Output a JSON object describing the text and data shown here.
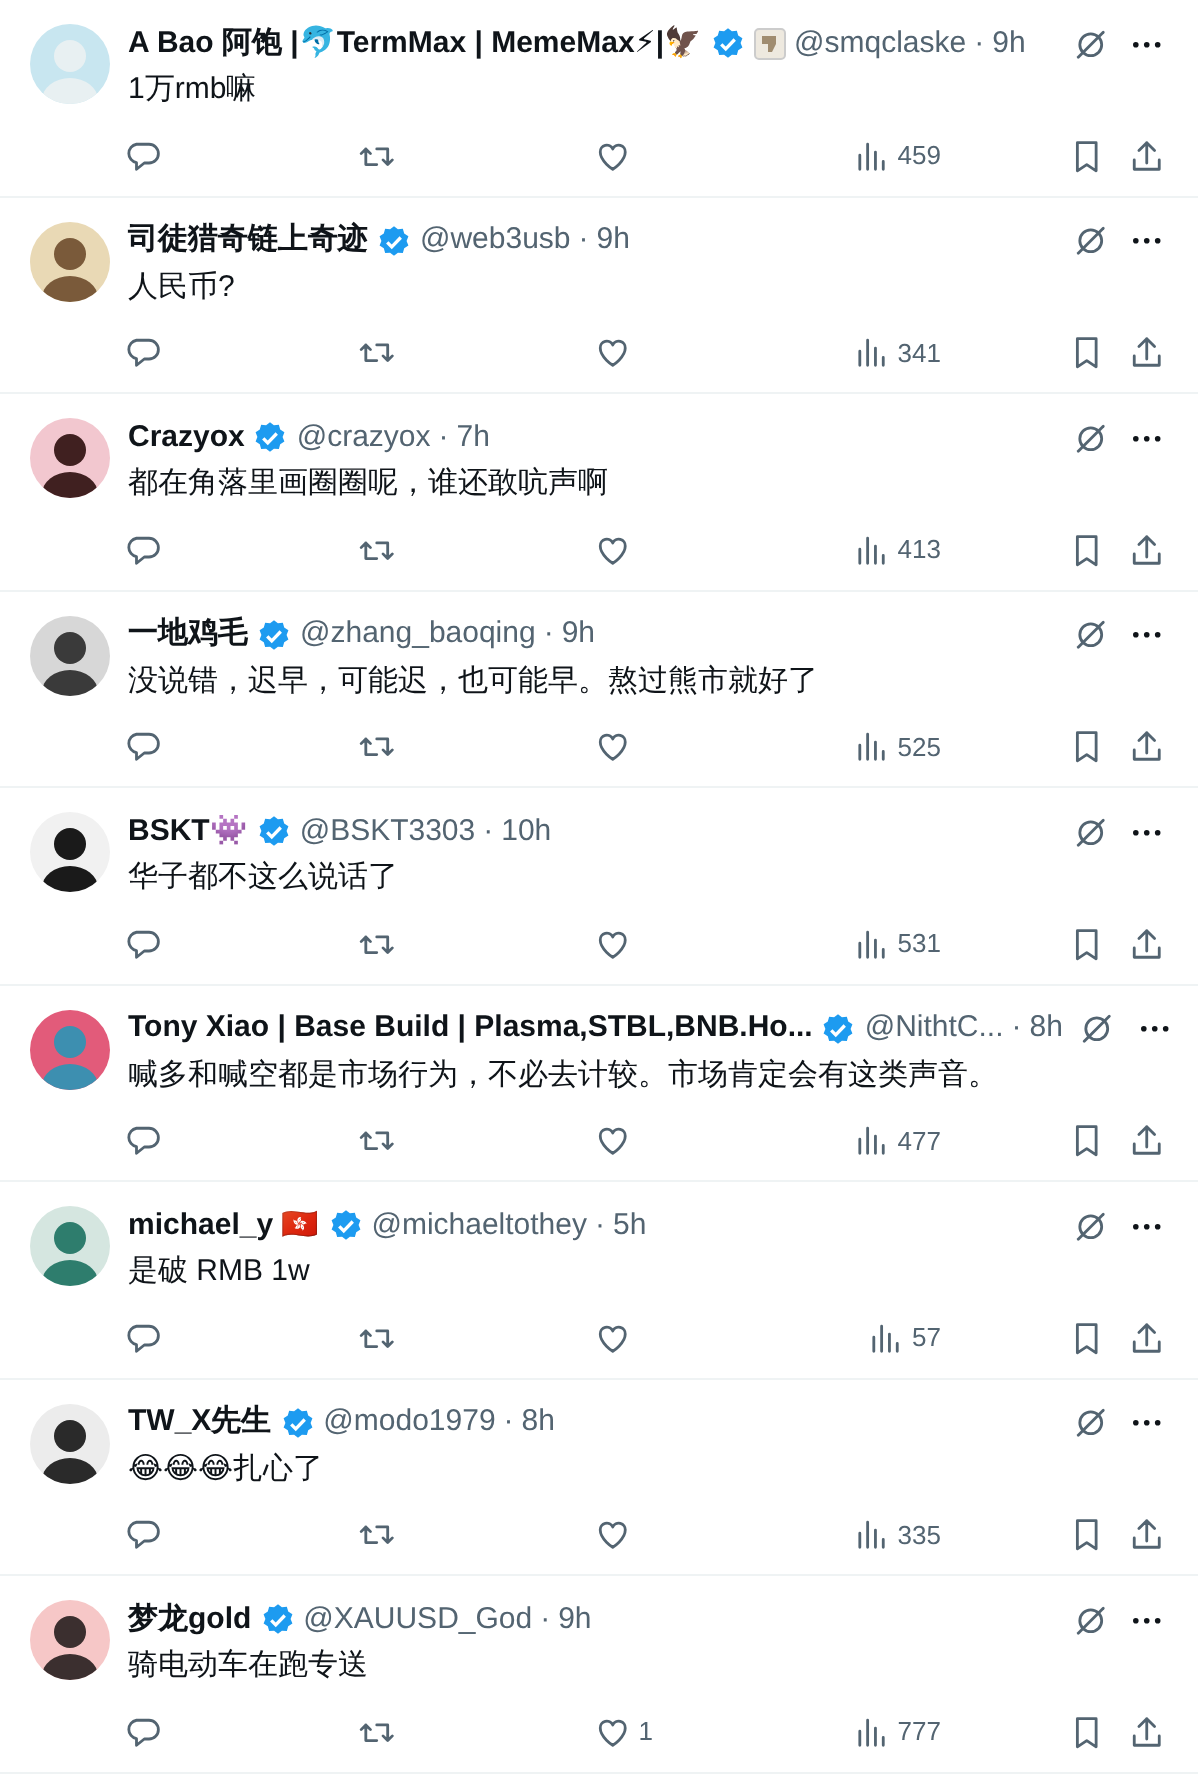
{
  "tweets": [
    {
      "name": "A Bao 阿饱 |🐬TermMax | MemeMax⚡|🦅",
      "verified": true,
      "affiliate_badge": true,
      "handle": "@smqclaske",
      "separator": "·",
      "time": "9h",
      "text": "1万rmb嘛",
      "views": "459"
    },
    {
      "name": "司徒猎奇链上奇迹",
      "verified": true,
      "handle": "@web3usb",
      "separator": "·",
      "time": "9h",
      "text": "人民币?",
      "views": "341"
    },
    {
      "name": "Crazyox",
      "verified": true,
      "handle": "@crazyox",
      "separator": "·",
      "time": "7h",
      "text": "都在角落里画圈圈呢，谁还敢吭声啊",
      "views": "413"
    },
    {
      "name": "一地鸡毛",
      "verified": true,
      "handle": "@zhang_baoqing",
      "separator": "·",
      "time": "9h",
      "text": "没说错，迟早，可能迟，也可能早。熬过熊市就好了",
      "views": "525"
    },
    {
      "name": "BSKT👾",
      "verified": true,
      "handle": "@BSKT3303",
      "separator": "·",
      "time": "10h",
      "text": "华子都不这么说话了",
      "views": "531"
    },
    {
      "name": "Tony Xiao | Base Build | Plasma,STBL,BNB.Ho...",
      "verified": true,
      "handle": "@NithtC...",
      "separator": "·",
      "time": "8h",
      "text": "喊多和喊空都是市场行为，不必去计较。市场肯定会有这类声音。",
      "views": "477"
    },
    {
      "name": "michael_y 🇭🇰",
      "verified": true,
      "handle": "@michaeltothey",
      "separator": "·",
      "time": "5h",
      "text": "是破 RMB 1w",
      "views": "57"
    },
    {
      "name": "TW_X先生",
      "verified": true,
      "handle": "@modo1979",
      "separator": "·",
      "time": "8h",
      "text": "😂😂😂扎心了",
      "views": "335"
    },
    {
      "name": "梦龙gold",
      "verified": true,
      "handle": "@XAUUSD_God",
      "separator": "·",
      "time": "9h",
      "text": "骑电动车在跑专送",
      "likes": "1",
      "views": "777"
    }
  ]
}
